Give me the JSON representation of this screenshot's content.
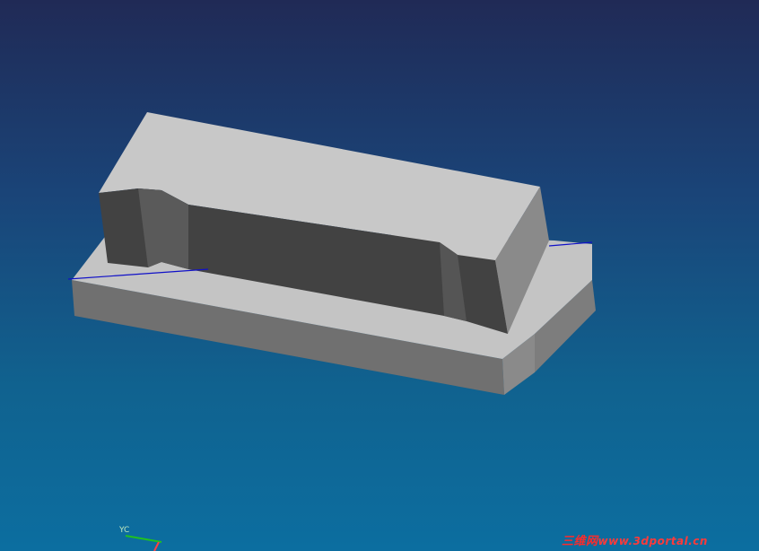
{
  "viewport": {
    "background_top": "#202a56",
    "background_bottom": "#0c6ea0",
    "model": "stepped-block-part"
  },
  "triad": {
    "y_axis_label": "YC",
    "y_axis_color": "#20c020",
    "z_axis_color": "#ff4040"
  },
  "watermark": {
    "chinese": "三维网",
    "url": "www.3dportal.cn",
    "color": "#ff2a2a"
  },
  "colors": {
    "face_top": "#c6c6c6",
    "face_dark": "#404040",
    "face_side": "#7d7d7d",
    "edge_line": "#1010c8"
  }
}
